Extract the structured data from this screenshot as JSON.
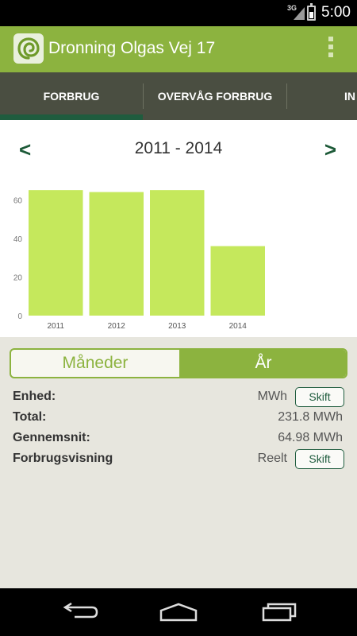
{
  "status_bar": {
    "network": "3G",
    "time": "5:00"
  },
  "app_bar": {
    "title": "Dronning Olgas Vej 17"
  },
  "tabs": [
    {
      "label": "FORBRUG",
      "active": true
    },
    {
      "label": "OVERVÅG FORBRUG",
      "active": false
    },
    {
      "label": "IN",
      "active": false
    }
  ],
  "chart_header": {
    "prev": "<",
    "range": "2011 - 2014",
    "next": ">"
  },
  "chart_data": {
    "type": "bar",
    "categories": [
      "2011",
      "2012",
      "2013",
      "2014"
    ],
    "values": [
      65,
      64,
      65,
      36
    ],
    "yticks": [
      0,
      20,
      40,
      60
    ],
    "ylim": [
      0,
      70
    ],
    "bar_color": "#c5e85c"
  },
  "segment": {
    "months": "Måneder",
    "year": "År",
    "selected": "year"
  },
  "info": {
    "unit": {
      "label": "Enhed:",
      "value": "MWh",
      "button": "Skift"
    },
    "total": {
      "label": "Total:",
      "value": "231.8 MWh"
    },
    "average": {
      "label": "Gennemsnit:",
      "value": "64.98 MWh"
    },
    "view": {
      "label": "Forbrugsvisning",
      "value": "Reelt",
      "button": "Skift"
    }
  },
  "colors": {
    "accent": "#8cb33f",
    "dark_green": "#1f5c3e",
    "tab_bar": "#4a4e41",
    "background": "#e7e6de"
  },
  "icons": [
    "app-logo-icon",
    "overflow-menu-icon",
    "back-icon",
    "home-icon",
    "recents-icon",
    "battery-icon",
    "signal-icon"
  ]
}
